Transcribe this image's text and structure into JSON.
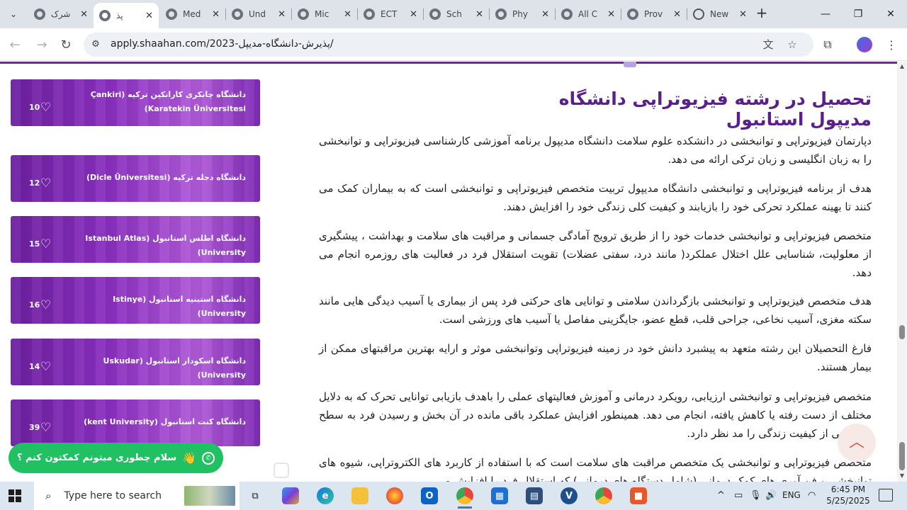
{
  "browser": {
    "tabs": [
      {
        "label": "شرک",
        "active": false,
        "favicon": "site-favicon"
      },
      {
        "label": "پذ",
        "active": true,
        "favicon": "site-favicon"
      },
      {
        "label": "Med",
        "active": false,
        "favicon": "site-favicon"
      },
      {
        "label": "Und",
        "active": false,
        "favicon": "site-favicon"
      },
      {
        "label": "Mic",
        "active": false,
        "favicon": "site-favicon"
      },
      {
        "label": "ECT",
        "active": false,
        "favicon": "site-favicon"
      },
      {
        "label": "Sch",
        "active": false,
        "favicon": "site-favicon"
      },
      {
        "label": "Phy",
        "active": false,
        "favicon": "site-favicon"
      },
      {
        "label": "All C",
        "active": false,
        "favicon": "site-favicon"
      },
      {
        "label": "Prov",
        "active": false,
        "favicon": "site-favicon"
      },
      {
        "label": "New",
        "active": false,
        "favicon": "globe-icon"
      }
    ],
    "new_tab_symbol": "+",
    "url": "apply.shaahan.com/2023-پذیرش-دانشگاه-مدیپل/",
    "icons": {
      "tab_search": "chevron-down-icon",
      "back": "back-arrow-icon",
      "forward": "forward-arrow-icon",
      "reload": "reload-icon",
      "site_info": "tune-icon",
      "translate": "translate-icon",
      "bookmark": "star-icon",
      "extensions": "puzzle-icon",
      "menu": "kebab-menu-icon"
    }
  },
  "sidebar": {
    "cards": [
      {
        "name": "دانشگاه چانکری کاراتکین ترکیه (Çankiri Karatekin Üniversitesi)",
        "count": "10"
      },
      {
        "name": "دانشگاه دجله ترکیه (Dicle Üniversitesi)",
        "count": "12"
      },
      {
        "name": "دانشگاه اطلس استانبول (Istanbul Atlas University)",
        "count": "15"
      },
      {
        "name": "دانشگاه استینیه استانبول (Istinye University)",
        "count": "16"
      },
      {
        "name": "دانشگاه اسکودار استانبول (Uskudar University)",
        "count": "14"
      },
      {
        "name": "دانشگاه کنت استانبول (kent University)",
        "count": "39"
      }
    ]
  },
  "chat": {
    "label": "سلام چطوری میتونم کمکتون کنم ؟",
    "wave": "👋"
  },
  "article": {
    "title": "تحصیل در رشته فیزیوتراپی دانشگاه مدیپول استانبول",
    "paragraphs": [
      "دپارتمان فیزیوتراپی و توانبخشی در دانشکده علوم سلامت دانشگاه مدیپول برنامه آموزشی کارشناسی فیزیوتراپی و توانبخشی را به زبان انگلیسی و زبان ترکی ارائه می دهد.",
      "هدف از برنامه فیزیوتراپی و توانبخشی دانشگاه مدیپول تربیت متخصص فیزیوتراپی و توانبخشی است که به بیماران کمک می کنند تا بهینه عملکرد تحرکی خود را بازیابند و کیفیت کلی زندگی خود را افزایش دهند.",
      "متخصص فیزیوتراپی و توانبخشی خدمات خود را از طریق ترویج آمادگی جسمانی و مراقبت های سلامت و بهداشت ، پیشگیری از معلولیت، شناسایی علل اختلال عملکرد( مانند درد، سفتی عضلات) تقویت استقلال فرد در فعالیت های روزمره انجام می دهد.",
      "هدف متخصص فیزیوتراپی و توانبخشی بازگرداندن سلامتی و توانایی های حرکتی فرد پس از بیماری یا آسیب دیدگی هایی مانند سکته مغزی، آسیب نخاعی، جراحی قلب، قطع عضو، جایگزینی مفاصل یا آسیب های ورزشی است.",
      "فارغ التحصیلان این رشته متعهد به پیشبرد دانش خود در زمینه فیزیوتراپی وتوانبخشی موثر و ارایه بهترین مراقبتهای ممکن از بیمار هستند.",
      "متخصص فیزیوتراپی و توانبخشی ارزیابی، رویکرد درمانی و آموزش فعالیتهای عملی را باهدف بازیابی توانایی تحرک که به دلایل مختلف از دست رفته یا کاهش یافته، انجام می دهد. همینطور افزایش عملکرد باقی مانده در آن بخش و رسیدن فرد به سطح مشخصی از کیفیت زندگی را مد نظر دارد.",
      "متخصص فیزیوتراپی و توانبخشی یک متخصص مراقبت های سلامت است که با استفاده از کاربرد های الکتروتراپی، شیوه های توانبخشی و فن آوری های کمک درمانی (شامل دستگاه های درمانی) که استقلال فرد را افزایش می"
    ]
  },
  "taskbar": {
    "search_placeholder": "Type here to search",
    "language": "ENG",
    "time": "6:45 PM",
    "date": "5/25/2025"
  }
}
